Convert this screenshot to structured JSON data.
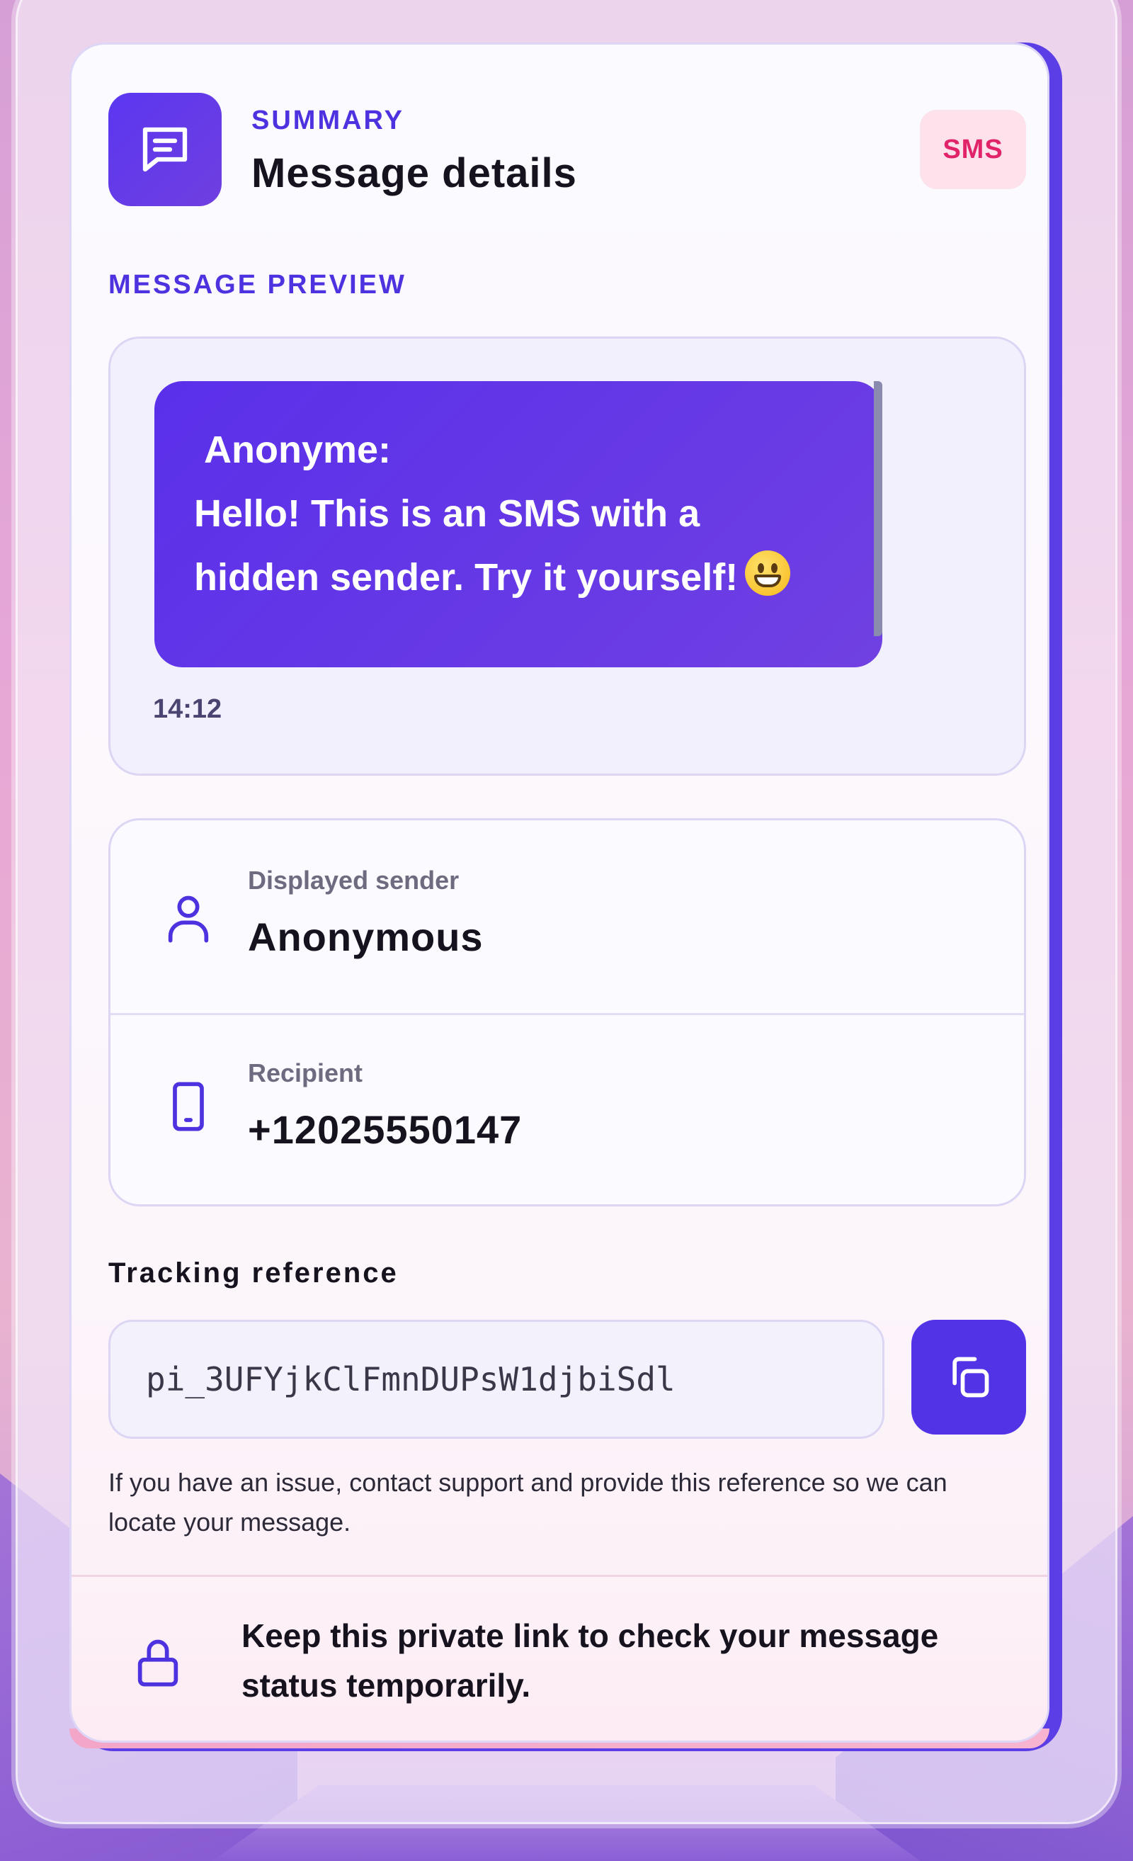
{
  "header": {
    "eyebrow": "SUMMARY",
    "title": "Message details",
    "badge": "SMS"
  },
  "preview": {
    "section_label": "MESSAGE PREVIEW",
    "sender_line": "Anonyme:",
    "body_line1": "Hello! This is an SMS with a",
    "body_line2": "hidden sender. Try it yourself!",
    "emoji_icon": "grinning-face-emoji",
    "time": "14:12"
  },
  "details": {
    "sender_label": "Displayed sender",
    "sender_value": "Anonymous",
    "sender_icon": "user-icon",
    "recipient_label": "Recipient",
    "recipient_value": "+12025550147",
    "recipient_icon": "phone-icon"
  },
  "tracking": {
    "label": "Tracking reference",
    "value": "pi_3UFYjkClFmnDUPsW1djbiSdl",
    "copy_icon": "copy-icon",
    "help": "If you have an issue, contact support and provide this reference so we can locate your message."
  },
  "footer": {
    "icon": "lock-icon",
    "text": "Keep this private link to check your message status temporarily."
  },
  "colors": {
    "accent": "#5233e6",
    "badge_bg": "#fde2ec",
    "badge_text": "#e1246a"
  }
}
